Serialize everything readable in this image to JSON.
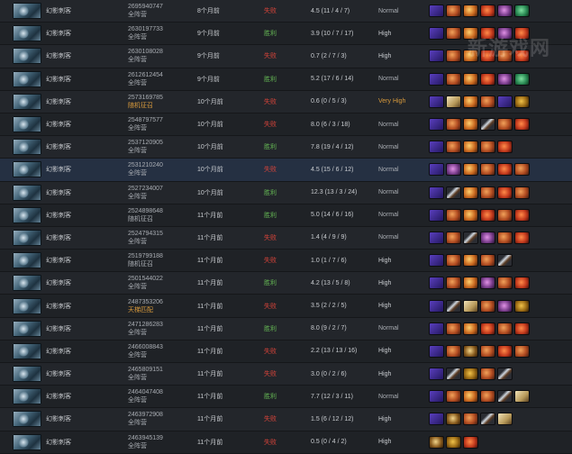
{
  "hero_name": "幻影刺客",
  "watermark": "新游戏网",
  "matches": [
    {
      "id": "2695940747",
      "mode": "全阵营",
      "mode_style": "normal",
      "time": "8个月前",
      "result": "失败",
      "result_type": "loss",
      "kda": "4.5 (11 / 4 / 7)",
      "skill": "Normal",
      "skill_style": "normal",
      "items": [
        "phase",
        "power",
        "bfury",
        "desol",
        "skadi",
        "butter"
      ]
    },
    {
      "id": "2630197733",
      "mode": "全阵营",
      "mode_style": "normal",
      "time": "9个月前",
      "result": "胜利",
      "result_type": "win",
      "kda": "3.9 (10 / 7 / 17)",
      "skill": "High",
      "skill_style": "high",
      "items": [
        "phase",
        "power",
        "bfury",
        "desol",
        "skadi",
        "desol"
      ]
    },
    {
      "id": "2630108028",
      "mode": "全阵营",
      "mode_style": "normal",
      "time": "9个月前",
      "result": "失败",
      "result_type": "loss",
      "kda": "0.7 (2 / 7 / 3)",
      "skill": "High",
      "skill_style": "high",
      "items": [
        "phase",
        "power",
        "bfury",
        "desol",
        "power",
        "desol"
      ]
    },
    {
      "id": "2612612454",
      "mode": "全阵营",
      "mode_style": "normal",
      "time": "9个月前",
      "result": "胜利",
      "result_type": "win",
      "kda": "5.2 (17 / 6 / 14)",
      "skill": "Normal",
      "skill_style": "normal",
      "items": [
        "phase",
        "power",
        "bfury",
        "desol",
        "skadi",
        "butter"
      ]
    },
    {
      "id": "2573169785",
      "mode": "随机征召",
      "mode_style": "orange",
      "time": "10个月前",
      "result": "失败",
      "result_type": "loss",
      "kda": "0.6 (0 / 5 / 3)",
      "skill": "Very High",
      "skill_style": "vhigh",
      "items": [
        "phase",
        "scroll",
        "bfury",
        "power",
        "phase",
        "mkb"
      ]
    },
    {
      "id": "2548797577",
      "mode": "全阵营",
      "mode_style": "normal",
      "time": "10个月前",
      "result": "失败",
      "result_type": "loss",
      "kda": "8.0 (6 / 3 / 18)",
      "skill": "Normal",
      "skill_style": "normal",
      "items": [
        "phase",
        "power",
        "bfury",
        "sword",
        "power",
        "desol"
      ]
    },
    {
      "id": "2537120905",
      "mode": "全阵营",
      "mode_style": "normal",
      "time": "10个月前",
      "result": "胜利",
      "result_type": "win",
      "kda": "7.8 (19 / 4 / 12)",
      "skill": "Normal",
      "skill_style": "normal",
      "items": [
        "phase",
        "power",
        "bfury",
        "power",
        "desol",
        "empty"
      ]
    },
    {
      "id": "2531210240",
      "mode": "全阵营",
      "mode_style": "normal",
      "time": "10个月前",
      "result": "失败",
      "result_type": "loss",
      "kda": "4.5 (15 / 6 / 12)",
      "skill": "Normal",
      "skill_style": "normal",
      "items": [
        "phase",
        "skadi",
        "bfury",
        "power",
        "desol",
        "power"
      ]
    },
    {
      "id": "2527234007",
      "mode": "全阵营",
      "mode_style": "normal",
      "time": "10个月前",
      "result": "胜利",
      "result_type": "win",
      "kda": "12.3 (13 / 3 / 24)",
      "skill": "Normal",
      "skill_style": "normal",
      "items": [
        "phase",
        "sword",
        "bfury",
        "power",
        "desol",
        "power"
      ]
    },
    {
      "id": "2524898648",
      "mode": "随机征召",
      "mode_style": "normal",
      "time": "11个月前",
      "result": "胜利",
      "result_type": "win",
      "kda": "5.0 (14 / 6 / 16)",
      "skill": "Normal",
      "skill_style": "normal",
      "items": [
        "phase",
        "power",
        "bfury",
        "desol",
        "power",
        "desol"
      ]
    },
    {
      "id": "2524794315",
      "mode": "全阵营",
      "mode_style": "normal",
      "time": "11个月前",
      "result": "失败",
      "result_type": "loss",
      "kda": "1.4 (4 / 9 / 9)",
      "skill": "Normal",
      "skill_style": "normal",
      "items": [
        "phase",
        "power",
        "sword",
        "skadi",
        "power",
        "desol"
      ]
    },
    {
      "id": "2519799188",
      "mode": "随机征召",
      "mode_style": "normal",
      "time": "11个月前",
      "result": "失败",
      "result_type": "loss",
      "kda": "1.0 (1 / 7 / 6)",
      "skill": "High",
      "skill_style": "high",
      "items": [
        "phase",
        "power",
        "bfury",
        "power",
        "sword",
        "empty"
      ]
    },
    {
      "id": "2501544022",
      "mode": "全阵营",
      "mode_style": "normal",
      "time": "11个月前",
      "result": "胜利",
      "result_type": "win",
      "kda": "4.2 (13 / 5 / 8)",
      "skill": "High",
      "skill_style": "high",
      "items": [
        "phase",
        "power",
        "bfury",
        "skadi",
        "power",
        "desol"
      ]
    },
    {
      "id": "2487353206",
      "mode": "天梯匹配",
      "mode_style": "orange",
      "time": "11个月前",
      "result": "失败",
      "result_type": "loss",
      "kda": "3.5 (2 / 2 / 5)",
      "skill": "High",
      "skill_style": "high",
      "items": [
        "phase",
        "sword",
        "scroll",
        "power",
        "skadi",
        "mkb"
      ]
    },
    {
      "id": "2471286283",
      "mode": "全阵营",
      "mode_style": "normal",
      "time": "11个月前",
      "result": "胜利",
      "result_type": "win",
      "kda": "8.0 (9 / 2 / 7)",
      "skill": "Normal",
      "skill_style": "normal",
      "items": [
        "phase",
        "power",
        "bfury",
        "desol",
        "power",
        "desol"
      ]
    },
    {
      "id": "2466008843",
      "mode": "全阵营",
      "mode_style": "normal",
      "time": "11个月前",
      "result": "失败",
      "result_type": "loss",
      "kda": "2.2 (13 / 13 / 16)",
      "skill": "High",
      "skill_style": "high",
      "items": [
        "phase",
        "power",
        "bkb",
        "power",
        "desol",
        "power"
      ]
    },
    {
      "id": "2465809151",
      "mode": "全阵营",
      "mode_style": "normal",
      "time": "11个月前",
      "result": "失败",
      "result_type": "loss",
      "kda": "3.0 (0 / 2 / 6)",
      "skill": "High",
      "skill_style": "high",
      "items": [
        "phase",
        "sword",
        "mkb",
        "power",
        "sword",
        "empty"
      ]
    },
    {
      "id": "2464047408",
      "mode": "全阵营",
      "mode_style": "normal",
      "time": "11个月前",
      "result": "胜利",
      "result_type": "win",
      "kda": "7.7 (12 / 3 / 11)",
      "skill": "Normal",
      "skill_style": "normal",
      "items": [
        "phase",
        "power",
        "bfury",
        "power",
        "sword",
        "scroll"
      ]
    },
    {
      "id": "2463972908",
      "mode": "全阵营",
      "mode_style": "normal",
      "time": "11个月前",
      "result": "失败",
      "result_type": "loss",
      "kda": "1.5 (6 / 12 / 12)",
      "skill": "High",
      "skill_style": "high",
      "items": [
        "phase",
        "bkb",
        "power",
        "sword",
        "scroll",
        "empty"
      ]
    },
    {
      "id": "2463945139",
      "mode": "全阵营",
      "mode_style": "normal",
      "time": "11个月前",
      "result": "失败",
      "result_type": "loss",
      "kda": "0.5 (0 / 4 / 2)",
      "skill": "High",
      "skill_style": "high",
      "items": [
        "bkb",
        "mkb",
        "desol",
        "empty",
        "empty",
        "empty"
      ]
    }
  ]
}
